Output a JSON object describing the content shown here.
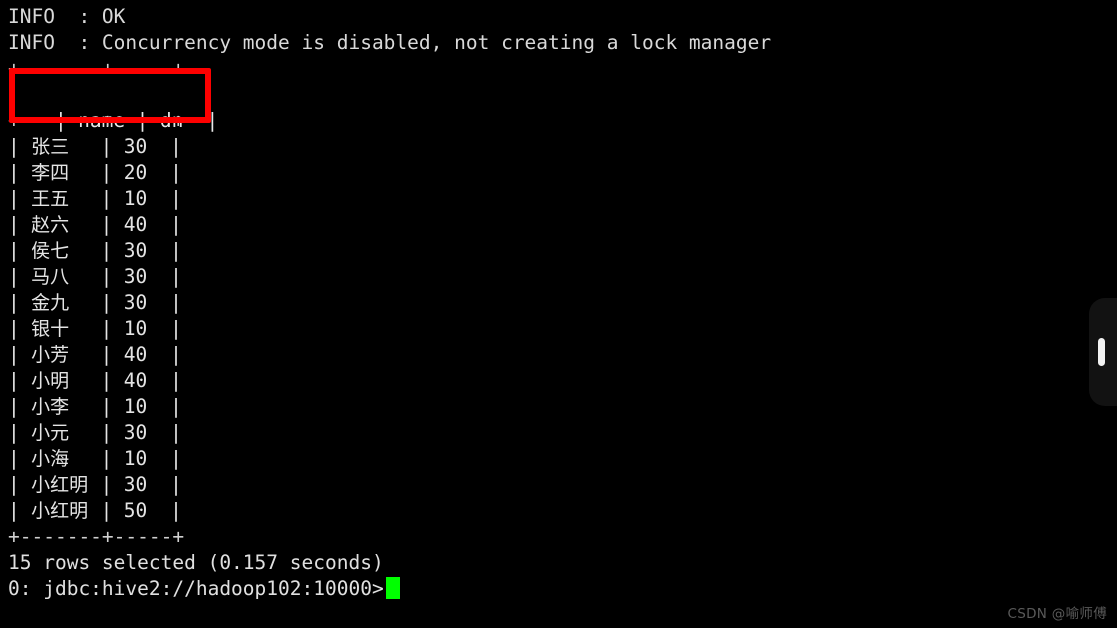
{
  "terminal": {
    "background_color": "#000000",
    "text_color": "#d8d8d8",
    "cursor_color": "#00ff00",
    "log_lines": [
      "INFO  : OK",
      "INFO  : Concurrency mode is disabled, not creating a lock manager"
    ],
    "table": {
      "top_border": "+-------+-----+",
      "header_border": "+-------+-----+",
      "bottom_border": "+-------+-----+",
      "columns": [
        "name",
        "dn"
      ],
      "header_row": "|  name | dn  |",
      "rows": [
        {
          "name": "张三",
          "dn": "30"
        },
        {
          "name": "李四",
          "dn": "20"
        },
        {
          "name": "王五",
          "dn": "10"
        },
        {
          "name": "赵六",
          "dn": "40"
        },
        {
          "name": "侯七",
          "dn": "30"
        },
        {
          "name": "马八",
          "dn": "30"
        },
        {
          "name": "金九",
          "dn": "30"
        },
        {
          "name": "银十",
          "dn": "10"
        },
        {
          "name": "小芳",
          "dn": "40"
        },
        {
          "name": "小明",
          "dn": "40"
        },
        {
          "name": "小李",
          "dn": "10"
        },
        {
          "name": "小元",
          "dn": "30"
        },
        {
          "name": "小海",
          "dn": "10"
        },
        {
          "name": "小红明",
          "dn": "30"
        },
        {
          "name": "小红明",
          "dn": "50"
        }
      ]
    },
    "result_summary": "15 rows selected (0.157 seconds)",
    "prompt": "0: jdbc:hive2://hadoop102:10000>",
    "cursor": "block"
  },
  "annotation": {
    "highlight_color": "#fe0000",
    "target": "table header row"
  },
  "scrollbar": {
    "track_color": "#121212",
    "thumb_color": "#f2f2f2"
  },
  "watermark": {
    "text": "CSDN @喻师傅",
    "color": "#5a5a5a"
  }
}
